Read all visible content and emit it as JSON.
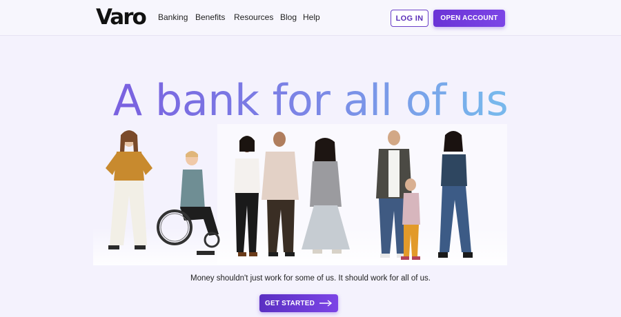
{
  "header": {
    "logo": "Varo",
    "nav": [
      {
        "label": "Banking"
      },
      {
        "label": "Benefits"
      },
      {
        "label": "Resources"
      },
      {
        "label": "Blog"
      },
      {
        "label": "Help"
      }
    ],
    "login_label": "LOG IN",
    "open_account_label": "OPEN ACCOUNT"
  },
  "hero": {
    "title": "A bank for all of us",
    "tagline": "Money shouldn't just work for some of us. It should work for all of us.",
    "cta_label": "GET STARTED",
    "cta_icon": "arrow-right-icon"
  },
  "colors": {
    "brand_purple": "#6a33d6",
    "title_gradient_start": "#7a62e0",
    "title_gradient_end": "#78b8ec",
    "background": "#f4f2fd"
  }
}
